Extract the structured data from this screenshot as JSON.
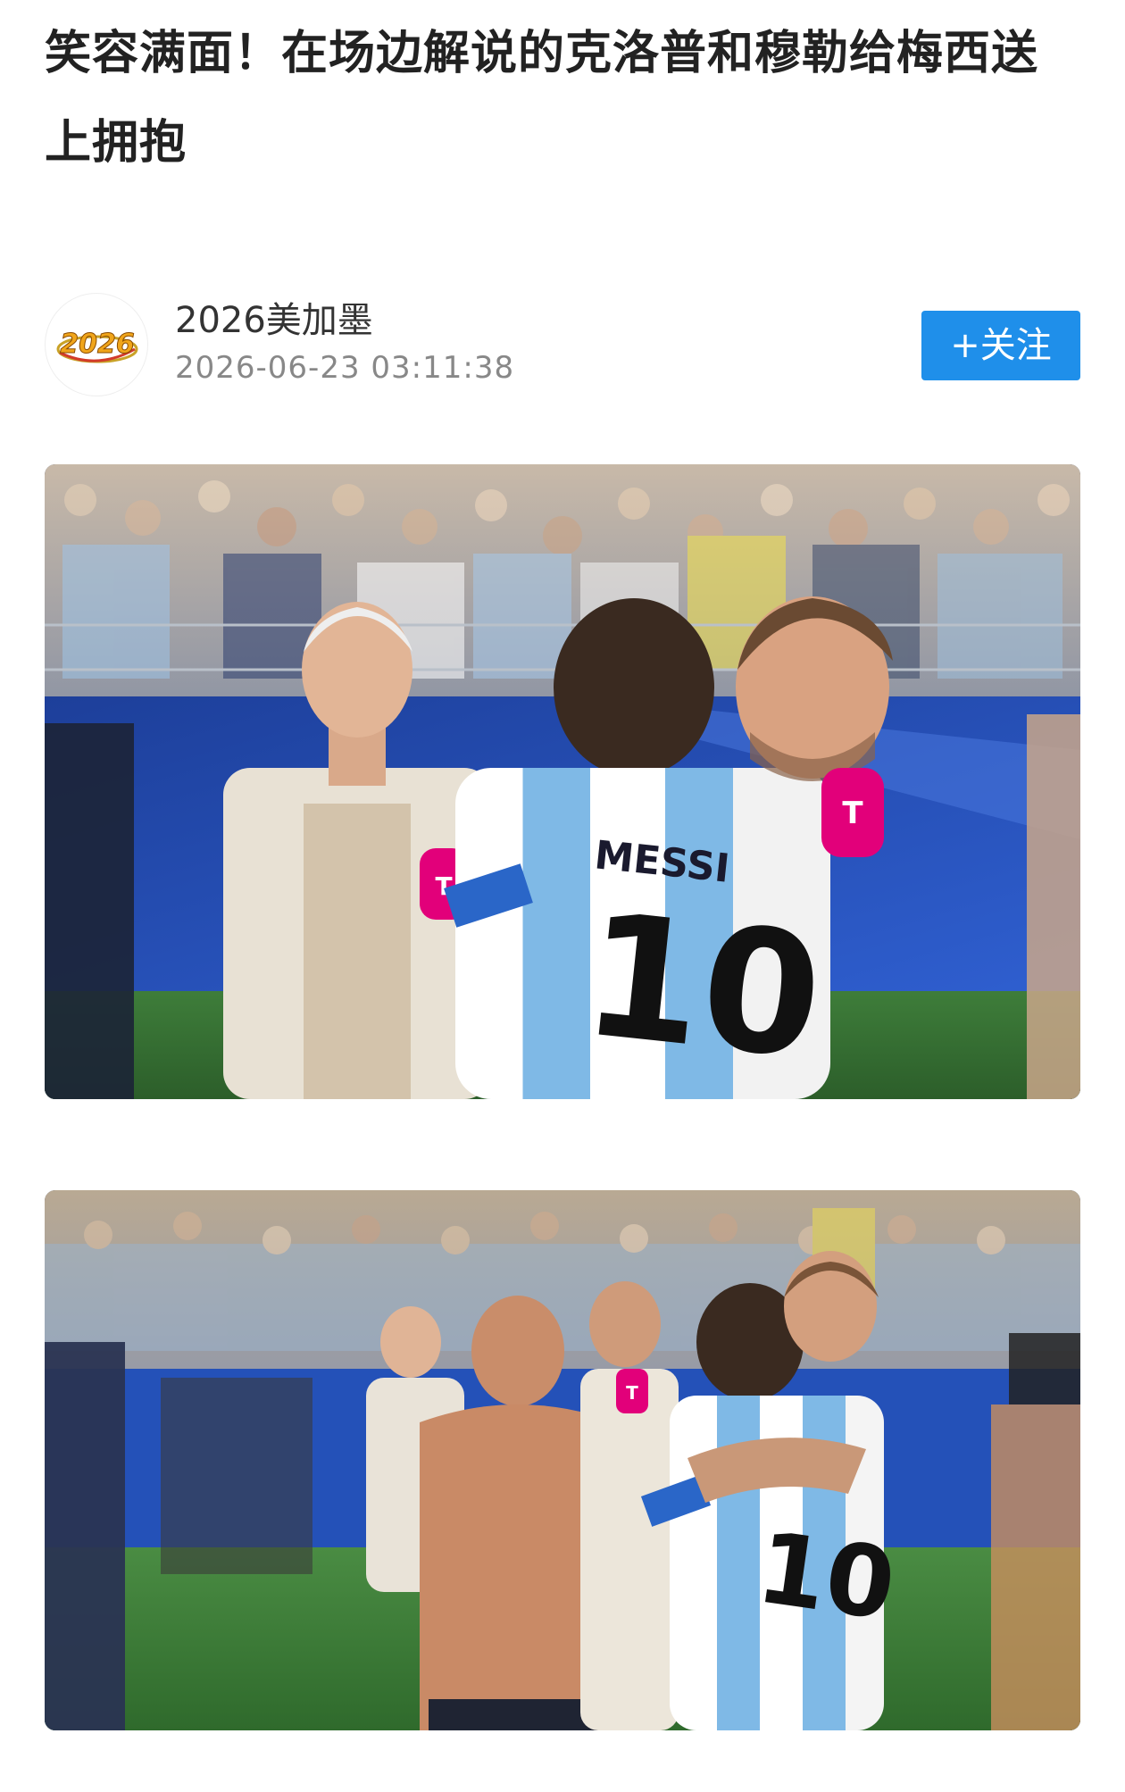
{
  "article": {
    "title": "笑容满面！在场边解说的克洛普和穆勒给梅西送上拥抱"
  },
  "author": {
    "name": "2026美加墨",
    "avatar_text": "2026",
    "publish_time": "2026-06-23 03:11:38",
    "follow_label": "+关注"
  },
  "photos": [
    {
      "jersey_name": "MESSI",
      "jersey_number": "10",
      "mic_logo": "T"
    },
    {
      "jersey_number": "10",
      "mic_logo": "T"
    }
  ],
  "colors": {
    "accent": "#1f8fea",
    "title": "#222222",
    "meta": "#888888",
    "mic": "#e2007a"
  }
}
